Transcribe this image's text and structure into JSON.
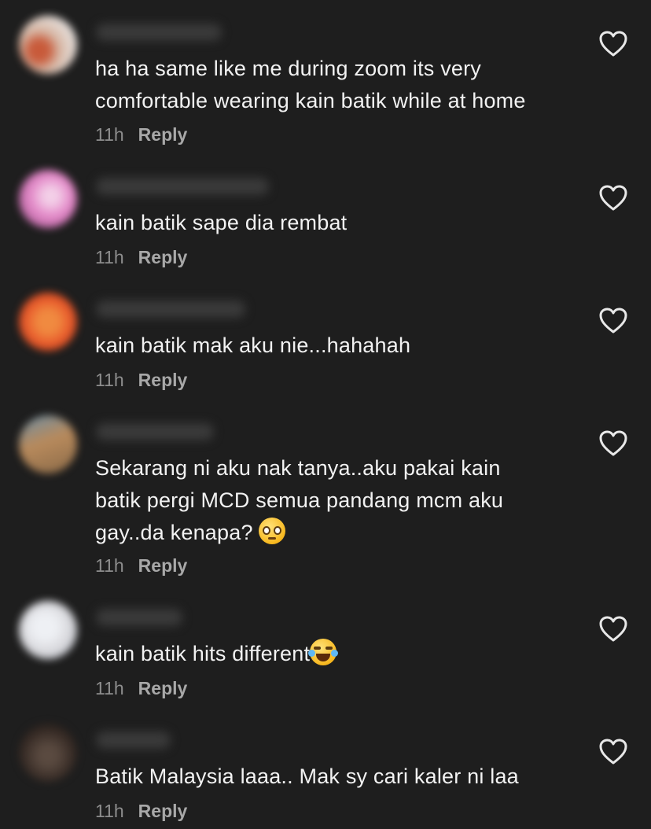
{
  "comments": [
    {
      "text": "ha ha same like me during zoom its very\ncomfortable wearing kain batik while at home",
      "time": "11h",
      "reply": "Reply",
      "avatar_color": "#d7b8a6",
      "avatar_accent": "#c85a3a"
    },
    {
      "text": "kain batik sape dia rembat",
      "time": "11h",
      "reply": "Reply",
      "avatar_color": "#e48ac9",
      "avatar_accent": "#f3d0e8"
    },
    {
      "text": "kain batik mak aku nie...hahahah",
      "time": "11h",
      "reply": "Reply",
      "avatar_color": "#e85a2c",
      "avatar_accent": "#f08a40"
    },
    {
      "text": "Sekarang ni aku nak tanya..aku pakai kain\nbatik pergi MCD semua pandang mcm aku\ngay..da kenapa? ",
      "emoji": "pleading-face-emoji",
      "time": "11h",
      "reply": "Reply",
      "avatar_color": "#b88a5c",
      "avatar_accent": "#6b8fa8"
    },
    {
      "text": "kain batik hits different",
      "emoji": "laughing-tears-emoji",
      "time": "11h",
      "reply": "Reply",
      "avatar_color": "#d8d8dc",
      "avatar_accent": "#bfc3cc"
    },
    {
      "text": "Batik Malaysia laaa.. Mak sy cari kaler ni laa",
      "time": "11h",
      "reply": "Reply",
      "avatar_color": "#3a2e28",
      "avatar_accent": "#5a4a40"
    }
  ],
  "colors": {
    "background": "#1e1e1e",
    "text": "#f2f2f2",
    "meta": "#8d8d8d"
  }
}
